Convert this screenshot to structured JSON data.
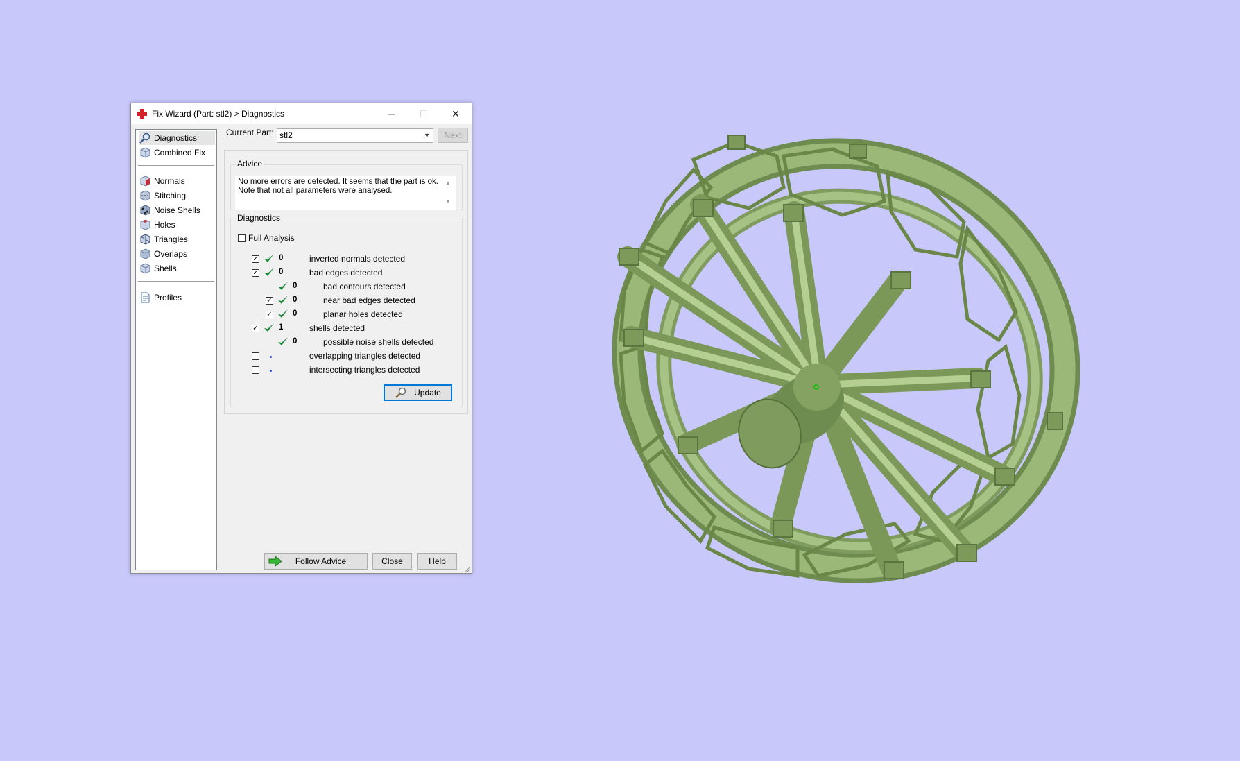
{
  "window": {
    "title": "Fix Wizard (Part: stl2) > Diagnostics",
    "minimize_glyph": "─",
    "maximize_glyph": "☐",
    "close_glyph": "✕"
  },
  "nav": {
    "items": [
      {
        "label": "Diagnostics",
        "icon": "magnifier-icon"
      },
      {
        "label": "Combined Fix",
        "icon": "cube-icon"
      },
      {
        "label": "Normals",
        "icon": "normals-icon"
      },
      {
        "label": "Stitching",
        "icon": "stitching-icon"
      },
      {
        "label": "Noise Shells",
        "icon": "noise-shells-icon"
      },
      {
        "label": "Holes",
        "icon": "holes-icon"
      },
      {
        "label": "Triangles",
        "icon": "triangles-icon"
      },
      {
        "label": "Overlaps",
        "icon": "overlaps-icon"
      },
      {
        "label": "Shells",
        "icon": "shells-icon"
      },
      {
        "label": "Profiles",
        "icon": "profiles-icon"
      }
    ]
  },
  "current_part": {
    "label": "Current Part:",
    "value": "stl2",
    "next_label": "Next"
  },
  "advice": {
    "group_label": "Advice",
    "line1": "No more errors are detected. It seems that the part is ok.",
    "line2": "Note that not all parameters were analysed."
  },
  "diagnostics": {
    "group_label": "Diagnostics",
    "full_analysis_label": "Full Analysis",
    "full_analysis_checked": false,
    "rows": [
      {
        "checked": true,
        "status": "ok",
        "count": "0",
        "label": "inverted normals detected"
      },
      {
        "checked": true,
        "status": "ok",
        "count": "0",
        "label": "bad edges detected"
      },
      {
        "checked": null,
        "status": "ok",
        "count": "0",
        "label": "bad contours detected"
      },
      {
        "checked": true,
        "status": "ok",
        "count": "0",
        "label": "near bad edges detected"
      },
      {
        "checked": true,
        "status": "ok",
        "count": "0",
        "label": "planar holes detected"
      },
      {
        "checked": true,
        "status": "ok",
        "count": "1",
        "label": "shells detected"
      },
      {
        "checked": null,
        "status": "ok",
        "count": "0",
        "label": "possible noise shells detected"
      },
      {
        "checked": false,
        "status": "not-analysed",
        "count": "",
        "label": "overlapping triangles detected"
      },
      {
        "checked": false,
        "status": "not-analysed",
        "count": "",
        "label": "intersecting triangles detected"
      }
    ],
    "update_label": "Update"
  },
  "footer": {
    "follow_label": "Follow Advice",
    "close_label": "Close",
    "help_label": "Help"
  },
  "check_glyph": "✓",
  "colors": {
    "background": "#c8c8fa",
    "model_green": "#8fac6a",
    "check_green": "#1e8a3c",
    "accent_blue": "#0078d7"
  }
}
